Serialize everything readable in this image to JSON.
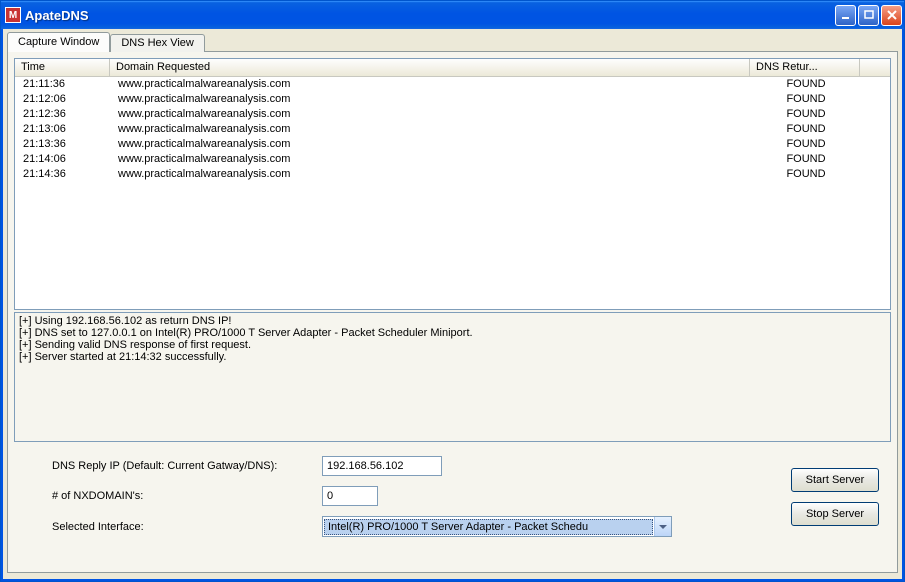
{
  "window": {
    "title": "ApateDNS"
  },
  "tabs": [
    {
      "label": "Capture Window",
      "active": true
    },
    {
      "label": "DNS Hex View",
      "active": false
    }
  ],
  "list": {
    "headers": {
      "time": "Time",
      "domain": "Domain Requested",
      "return": "DNS Retur..."
    },
    "rows": [
      {
        "time": "21:11:36",
        "domain": "www.practicalmalwareanalysis.com",
        "return": "FOUND"
      },
      {
        "time": "21:12:06",
        "domain": "www.practicalmalwareanalysis.com",
        "return": "FOUND"
      },
      {
        "time": "21:12:36",
        "domain": "www.practicalmalwareanalysis.com",
        "return": "FOUND"
      },
      {
        "time": "21:13:06",
        "domain": "www.practicalmalwareanalysis.com",
        "return": "FOUND"
      },
      {
        "time": "21:13:36",
        "domain": "www.practicalmalwareanalysis.com",
        "return": "FOUND"
      },
      {
        "time": "21:14:06",
        "domain": "www.practicalmalwareanalysis.com",
        "return": "FOUND"
      },
      {
        "time": "21:14:36",
        "domain": "www.practicalmalwareanalysis.com",
        "return": "FOUND"
      }
    ]
  },
  "log_lines": [
    "[+] Using 192.168.56.102 as return DNS IP!",
    "[+] DNS set to 127.0.0.1 on Intel(R) PRO/1000 T Server Adapter - Packet Scheduler Miniport.",
    "[+] Sending valid DNS response of first request.",
    "[+] Server started at 21:14:32 successfully."
  ],
  "form": {
    "reply_ip_label": "DNS Reply IP (Default: Current Gatway/DNS):",
    "reply_ip_value": "192.168.56.102",
    "nxdomain_label": "# of NXDOMAIN's:",
    "nxdomain_value": "0",
    "interface_label": "Selected Interface:",
    "interface_value": "Intel(R) PRO/1000 T Server Adapter - Packet Schedu"
  },
  "buttons": {
    "start": "Start Server",
    "stop": "Stop Server"
  }
}
